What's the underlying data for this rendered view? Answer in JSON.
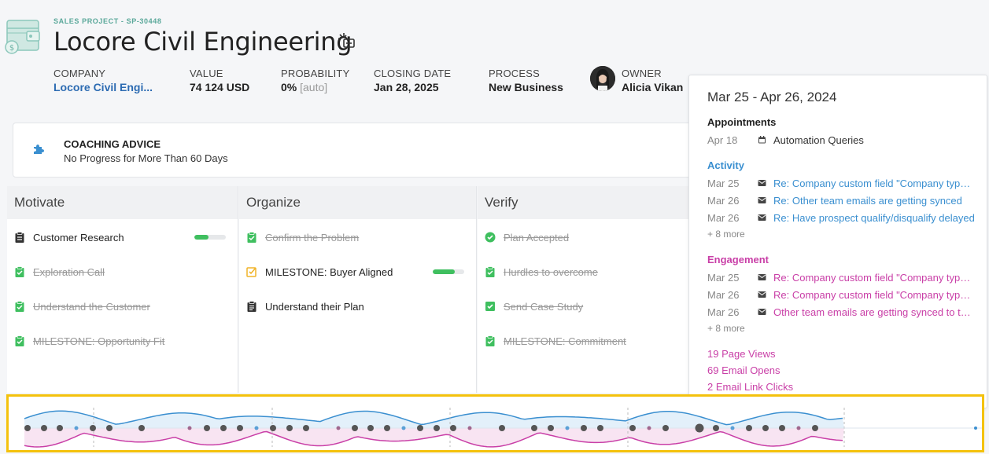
{
  "header": {
    "crumb": "SALES PROJECT - SP-30448",
    "title": "Locore Civil Engineering",
    "icon": "wallet-dollar-icon",
    "magic_icon": "magic-wand-icon"
  },
  "meta": {
    "company": {
      "label": "COMPANY",
      "value": "Locore Civil Engi..."
    },
    "value": {
      "label": "VALUE",
      "value": "74 124 USD"
    },
    "probability": {
      "label": "PROBABILITY",
      "value": "0%",
      "auto": "[auto]"
    },
    "closing": {
      "label": "CLOSING DATE",
      "value": "Jan 28, 2025"
    },
    "process": {
      "label": "PROCESS",
      "value": "New Business"
    },
    "owner": {
      "label": "OWNER",
      "value": "Alicia Vikan"
    }
  },
  "coaching": {
    "title": "COACHING ADVICE",
    "text": "No Progress for More Than 60 Days",
    "icon": "puzzle-icon"
  },
  "stages": [
    {
      "name": "Motivate",
      "tasks": [
        {
          "label": "Customer Research",
          "done": false,
          "icon": "clipboard-icon",
          "progress": 0.45
        },
        {
          "label": "Exploration Call",
          "done": true,
          "icon": "clipboard-check-icon"
        },
        {
          "label": "Understand the Customer",
          "done": true,
          "icon": "clipboard-check-icon"
        },
        {
          "label": "MILESTONE: Opportunity Fit",
          "done": true,
          "icon": "clipboard-check-icon"
        }
      ]
    },
    {
      "name": "Organize",
      "tasks": [
        {
          "label": "Confirm the Problem",
          "done": true,
          "icon": "clipboard-check-icon"
        },
        {
          "label": "MILESTONE: Buyer Aligned",
          "done": false,
          "icon": "checkbox-edit-icon",
          "progress": 0.7
        },
        {
          "label": "Understand their Plan",
          "done": false,
          "icon": "clipboard-list-icon"
        }
      ]
    },
    {
      "name": "Verify",
      "tasks": [
        {
          "label": "Plan Accepted",
          "done": true,
          "icon": "check-circle-icon"
        },
        {
          "label": "Hurdles to overcome",
          "done": true,
          "icon": "clipboard-check-icon"
        },
        {
          "label": "Send Case Study",
          "done": true,
          "icon": "check-square-icon"
        },
        {
          "label": "MILESTONE: Commitment",
          "done": true,
          "icon": "clipboard-check-icon"
        }
      ]
    }
  ],
  "panel": {
    "range": "Mar 25 - Apr 26, 2024",
    "appointments": {
      "title": "Appointments",
      "items": [
        {
          "date": "Apr 18",
          "text": "Automation Queries",
          "icon": "calendar-icon"
        }
      ]
    },
    "activity": {
      "title": "Activity",
      "items": [
        {
          "date": "Mar 25",
          "text": "Re: Company custom field \"Company type\" not syncing",
          "icon": "envelope-icon"
        },
        {
          "date": "Mar 26",
          "text": "Re: Other team emails are getting synced",
          "icon": "envelope-icon"
        },
        {
          "date": "Mar 26",
          "text": "Re: Have prospect qualify/disqualify delayed",
          "icon": "envelope-icon"
        }
      ],
      "more": "+ 8 more"
    },
    "engagement": {
      "title": "Engagement",
      "items": [
        {
          "date": "Mar 25",
          "text": "Re: Company custom field \"Company type\" not syncing",
          "icon": "envelope-icon"
        },
        {
          "date": "Mar 26",
          "text": "Re: Company custom field \"Company type\" not syncing",
          "icon": "envelope-icon"
        },
        {
          "date": "Mar 26",
          "text": "Other team emails are getting synced to the system",
          "icon": "envelope-icon"
        }
      ],
      "more": "+ 8 more"
    },
    "stats": [
      "19 Page Views",
      "69 Email Opens",
      "2 Email Link Clicks"
    ]
  },
  "colors": {
    "activity": "#3a8fd0",
    "engagement": "#c93fa7",
    "accent_green": "#3fbf5f",
    "highlight": "#f4c20d"
  }
}
